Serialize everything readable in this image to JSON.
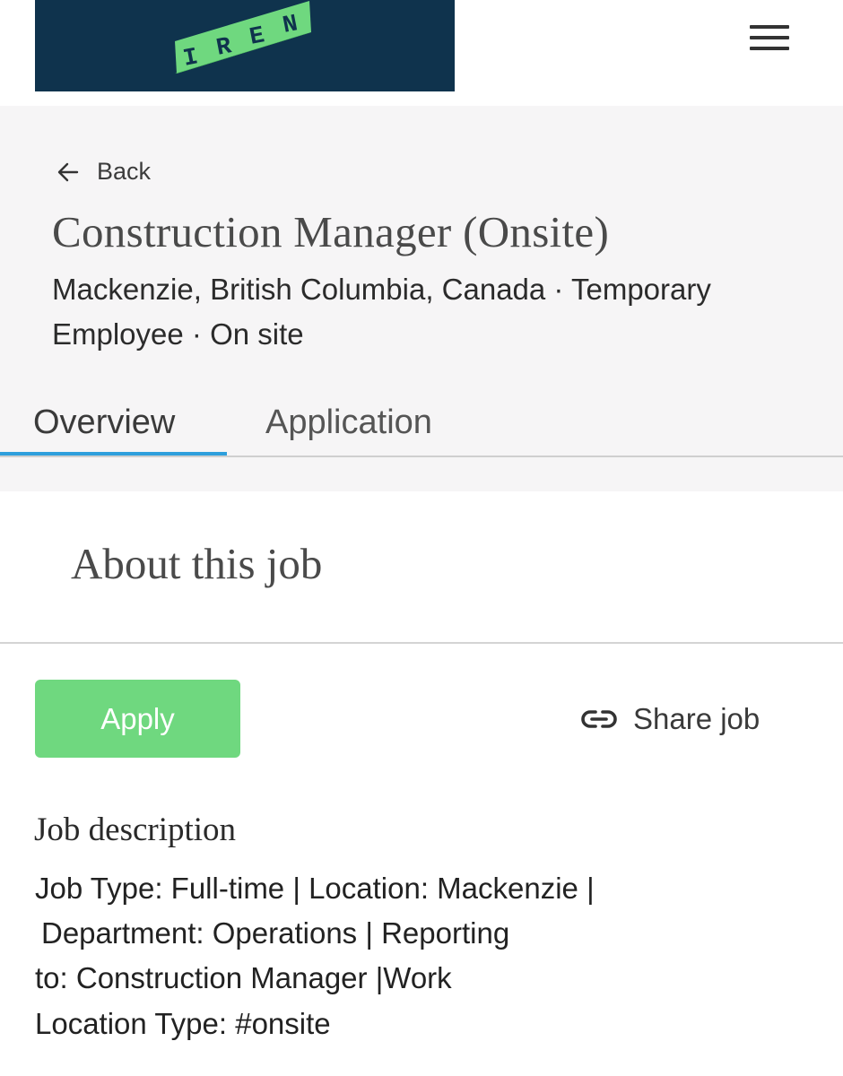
{
  "brand": {
    "logo_text": "IREN",
    "logo_color": "#6fd87f",
    "bg_color": "#0f334d"
  },
  "nav": {
    "menu_icon": "hamburger-icon"
  },
  "header": {
    "back_label": "Back",
    "back_icon": "arrow-left-icon",
    "title": "Construction Manager (Onsite)",
    "meta": "Mackenzie, British Columbia, Canada · Temporary Employee · On site"
  },
  "tabs": [
    {
      "label": "Overview",
      "active": true
    },
    {
      "label": "Application",
      "active": false
    }
  ],
  "accent_color": "#2e9fdc",
  "about": {
    "title": "About this job"
  },
  "actions": {
    "apply_label": "Apply",
    "apply_color": "#6fd87f",
    "share_label": "Share job",
    "share_icon": "link-icon"
  },
  "description": {
    "heading": "Job description",
    "lines": [
      "Job Type:  Full-time | Location:  Mackenzie |",
      "Department: Operations | Reporting",
      "to: Construction Manager |Work",
      "Location Type:  #onsite"
    ]
  }
}
